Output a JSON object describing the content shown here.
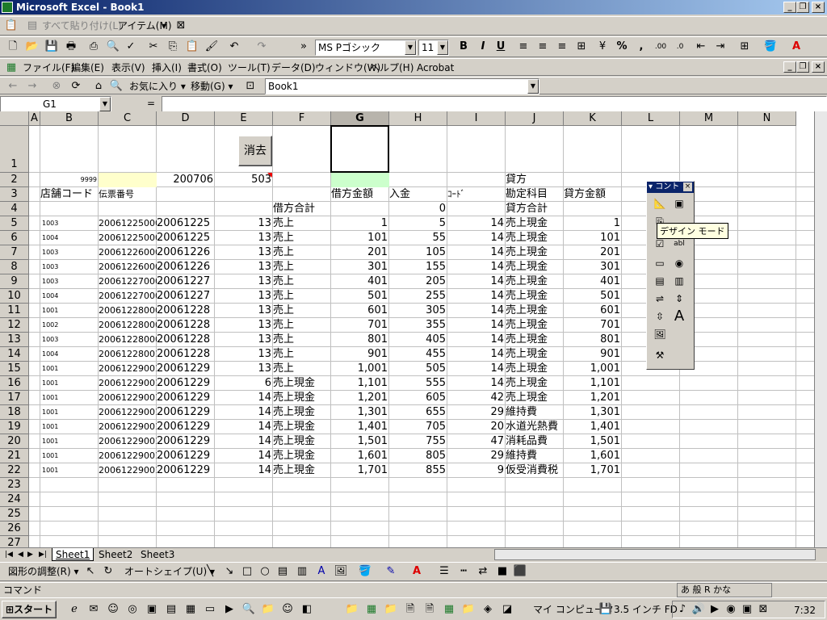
{
  "window": {
    "title": "Microsoft Excel - Book1"
  },
  "clipboard_bar": {
    "paste_all": "すべて貼り付け(L)",
    "items_menu": "アイテム(M)"
  },
  "format_toolbar": {
    "font_name": "MS Pゴシック",
    "font_size": "11"
  },
  "menu": {
    "items": [
      "ファイル(F)",
      "編集(E)",
      "表示(V)",
      "挿入(I)",
      "書式(O)",
      "ツール(T)",
      "データ(D)",
      "ウィンドウ(W)",
      "ヘルプ(H)",
      "Acrobat"
    ]
  },
  "web_toolbar": {
    "favorites": "お気に入り",
    "go": "移動(G)",
    "address": "Book1"
  },
  "formula_bar": {
    "name_box": "G1",
    "equals": "=",
    "value": ""
  },
  "columns": [
    "A",
    "B",
    "C",
    "D",
    "E",
    "F",
    "G",
    "H",
    "I",
    "J",
    "K",
    "L",
    "M",
    "N"
  ],
  "sheet": {
    "clear_button": "消去",
    "row2": {
      "B": "9999",
      "D": "200706",
      "E": "503",
      "J": "貸方"
    },
    "row3": {
      "B": "店舗コード",
      "C": "伝票番号",
      "G": "借方金額",
      "H": "入金",
      "I": "ｺｰﾄﾞ",
      "J": "勘定科目",
      "K": "貸方金額"
    },
    "row4": {
      "F": "借方合計",
      "H": "0",
      "J": "貸方合計"
    },
    "rows": [
      {
        "r": "5",
        "B": "1003",
        "C": "200612250001",
        "D": "20061225",
        "E": "13",
        "F": "売上",
        "G": "1",
        "H": "5",
        "I": "14",
        "J": "売上現金",
        "K": "1"
      },
      {
        "r": "6",
        "B": "1004",
        "C": "200612250002",
        "D": "20061225",
        "E": "13",
        "F": "売上",
        "G": "101",
        "H": "55",
        "I": "14",
        "J": "売上現金",
        "K": "101"
      },
      {
        "r": "7",
        "B": "1003",
        "C": "200612260003",
        "D": "20061226",
        "E": "13",
        "F": "売上",
        "G": "201",
        "H": "105",
        "I": "14",
        "J": "売上現金",
        "K": "201"
      },
      {
        "r": "8",
        "B": "1003",
        "C": "200612260004",
        "D": "20061226",
        "E": "13",
        "F": "売上",
        "G": "301",
        "H": "155",
        "I": "14",
        "J": "売上現金",
        "K": "301"
      },
      {
        "r": "9",
        "B": "1003",
        "C": "200612270005",
        "D": "20061227",
        "E": "13",
        "F": "売上",
        "G": "401",
        "H": "205",
        "I": "14",
        "J": "売上現金",
        "K": "401"
      },
      {
        "r": "10",
        "B": "1004",
        "C": "200612270006",
        "D": "20061227",
        "E": "13",
        "F": "売上",
        "G": "501",
        "H": "255",
        "I": "14",
        "J": "売上現金",
        "K": "501"
      },
      {
        "r": "11",
        "B": "1001",
        "C": "200612280007",
        "D": "20061228",
        "E": "13",
        "F": "売上",
        "G": "601",
        "H": "305",
        "I": "14",
        "J": "売上現金",
        "K": "601"
      },
      {
        "r": "12",
        "B": "1002",
        "C": "200612280008",
        "D": "20061228",
        "E": "13",
        "F": "売上",
        "G": "701",
        "H": "355",
        "I": "14",
        "J": "売上現金",
        "K": "701"
      },
      {
        "r": "13",
        "B": "1003",
        "C": "200612280009",
        "D": "20061228",
        "E": "13",
        "F": "売上",
        "G": "801",
        "H": "405",
        "I": "14",
        "J": "売上現金",
        "K": "801"
      },
      {
        "r": "14",
        "B": "1004",
        "C": "200612280010",
        "D": "20061228",
        "E": "13",
        "F": "売上",
        "G": "901",
        "H": "455",
        "I": "14",
        "J": "売上現金",
        "K": "901"
      },
      {
        "r": "15",
        "B": "1001",
        "C": "200612290011",
        "D": "20061229",
        "E": "13",
        "F": "売上",
        "G": "1,001",
        "H": "505",
        "I": "14",
        "J": "売上現金",
        "K": "1,001"
      },
      {
        "r": "16",
        "B": "1001",
        "C": "200612290012",
        "D": "20061229",
        "E": "6",
        "F": "売上現金",
        "G": "1,101",
        "H": "555",
        "I": "14",
        "J": "売上現金",
        "K": "1,101"
      },
      {
        "r": "17",
        "B": "1001",
        "C": "200612290013",
        "D": "20061229",
        "E": "14",
        "F": "売上現金",
        "G": "1,201",
        "H": "605",
        "I": "42",
        "J": "売上現金",
        "K": "1,201"
      },
      {
        "r": "18",
        "B": "1001",
        "C": "200612290014",
        "D": "20061229",
        "E": "14",
        "F": "売上現金",
        "G": "1,301",
        "H": "655",
        "I": "29",
        "J": "維持費",
        "K": "1,301"
      },
      {
        "r": "19",
        "B": "1001",
        "C": "200612290015",
        "D": "20061229",
        "E": "14",
        "F": "売上現金",
        "G": "1,401",
        "H": "705",
        "I": "20",
        "J": "水道光熱費",
        "K": "1,401"
      },
      {
        "r": "20",
        "B": "1001",
        "C": "200612290016",
        "D": "20061229",
        "E": "14",
        "F": "売上現金",
        "G": "1,501",
        "H": "755",
        "I": "47",
        "J": "消耗品費",
        "K": "1,501"
      },
      {
        "r": "21",
        "B": "1001",
        "C": "200612290017",
        "D": "20061229",
        "E": "14",
        "F": "売上現金",
        "G": "1,601",
        "H": "805",
        "I": "29",
        "J": "維持費",
        "K": "1,601"
      },
      {
        "r": "22",
        "B": "1001",
        "C": "200612290018",
        "D": "20061229",
        "E": "14",
        "F": "売上現金",
        "G": "1,701",
        "H": "855",
        "I": "9",
        "J": "仮受消費税",
        "K": "1,701"
      }
    ],
    "empty_rows": [
      "23",
      "24",
      "25",
      "26",
      "27"
    ]
  },
  "control_toolbox": {
    "title": "コント",
    "tooltip": "デザイン モード"
  },
  "sheet_tabs": [
    "Sheet1",
    "Sheet2",
    "Sheet3"
  ],
  "drawing_toolbar": {
    "draw": "図形の調整(R)",
    "autoshapes": "オートシェイプ(U)"
  },
  "status_bar": {
    "mode": "コマンド",
    "ime": "あ 般 R かな"
  },
  "taskbar": {
    "start": "スタート",
    "my_computer": "マイ コンピュータ",
    "floppy": "3.5 インチ FD",
    "clock": "7:32"
  }
}
